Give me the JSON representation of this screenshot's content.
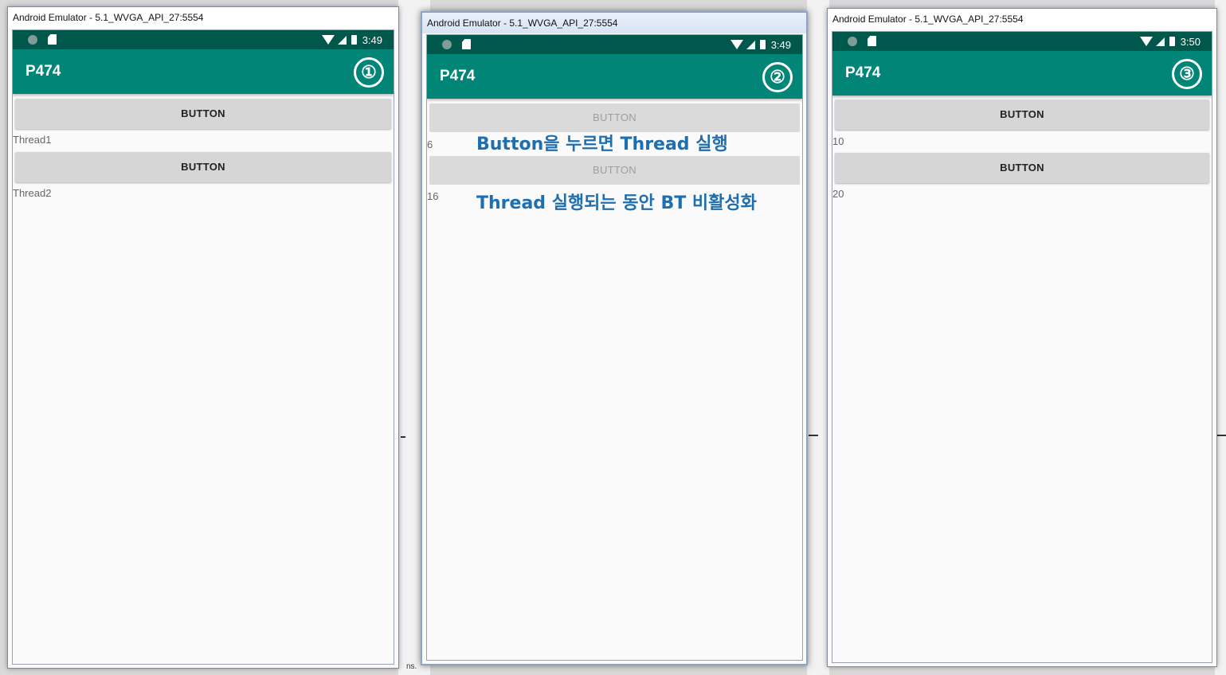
{
  "emulators": [
    {
      "window_title": "Android Emulator - 5.1_WVGA_API_27:5554",
      "time": "3:49",
      "app_title": "P474",
      "step_badge": "①",
      "button1_label": "BUTTON",
      "text1": "Thread1",
      "button2_label": "BUTTON",
      "text2": "Thread2"
    },
    {
      "window_title": "Android Emulator - 5.1_WVGA_API_27:5554",
      "time": "3:49",
      "app_title": "P474",
      "step_badge": "②",
      "button1_label": "BUTTON",
      "text1": "6",
      "button2_label": "BUTTON",
      "text2": "16",
      "annotation1": "Button을 누르면 Thread 실행",
      "annotation2": "Thread 실행되는 동안 BT 비활성화"
    },
    {
      "window_title": "Android Emulator - 5.1_WVGA_API_27:5554",
      "time": "3:50",
      "app_title": "P474",
      "step_badge": "③",
      "button1_label": "BUTTON",
      "text1": "10",
      "button2_label": "BUTTON",
      "text2": "20"
    }
  ],
  "colors": {
    "status_bar": "#00574b",
    "app_bar": "#008577",
    "annotation": "#1f6fb0"
  },
  "background_fragment": "ns."
}
